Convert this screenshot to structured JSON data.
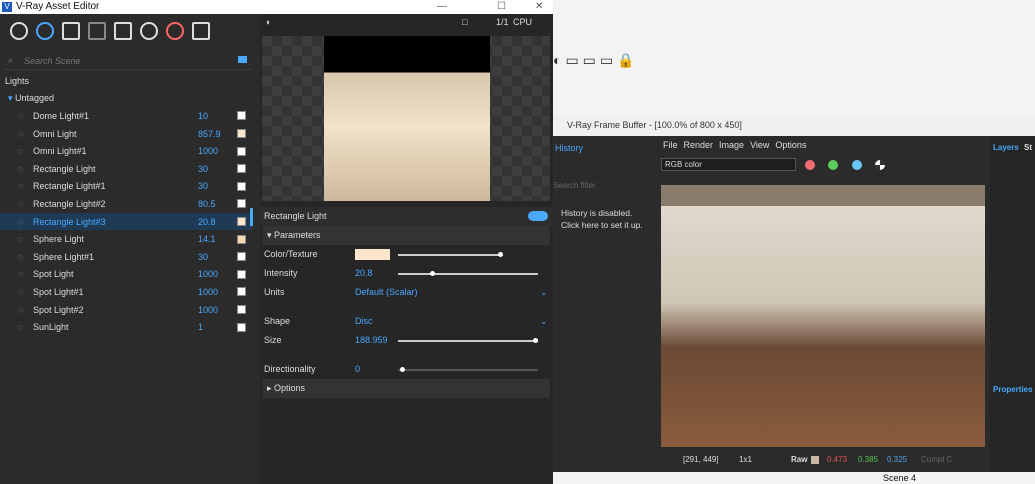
{
  "asset_editor": {
    "title": "V-Ray Asset Editor",
    "search_placeholder": "Search Scene",
    "category": "Lights",
    "tag": "Untagged",
    "lights": [
      {
        "name": "Dome Light#1",
        "value": "10",
        "color": "#ffffff"
      },
      {
        "name": "Omni Light",
        "value": "857.9",
        "color": "#fbe6cc"
      },
      {
        "name": "Omni Light#1",
        "value": "1000",
        "color": "#ffffff"
      },
      {
        "name": "Rectangle Light",
        "value": "30",
        "color": "#ffffff"
      },
      {
        "name": "Rectangle Light#1",
        "value": "30",
        "color": "#ffffff"
      },
      {
        "name": "Rectangle Light#2",
        "value": "80.5",
        "color": "#ffffff"
      },
      {
        "name": "Rectangle Light#3",
        "value": "20.8",
        "color": "#fbe6cc",
        "selected": true
      },
      {
        "name": "Sphere Light",
        "value": "14.1",
        "color": "#fbd9b0"
      },
      {
        "name": "Sphere Light#1",
        "value": "30",
        "color": "#ffffff"
      },
      {
        "name": "Spot Light",
        "value": "1000",
        "color": "#ffffff"
      },
      {
        "name": "Spot Light#1",
        "value": "1000",
        "color": "#ffffff"
      },
      {
        "name": "Spot Light#2",
        "value": "1000",
        "color": "#ffffff"
      },
      {
        "name": "SunLight",
        "value": "1",
        "color": "#ffffff"
      }
    ],
    "preview": {
      "ratio": "1/1",
      "engine": "CPU"
    },
    "props": {
      "title": "Rectangle Light",
      "parameters": "Parameters",
      "color_label": "Color/Texture",
      "intensity_label": "Intensity",
      "intensity": "20.8",
      "units_label": "Units",
      "units": "Default (Scalar)",
      "shape_label": "Shape",
      "shape": "Disc",
      "size_label": "Size",
      "size": "188.959",
      "dir_label": "Directionality",
      "dir": "0",
      "options": "Options"
    }
  },
  "frame_buffer": {
    "title": "V-Ray Frame Buffer - [100.0% of 800 x 450]",
    "history_tab": "History",
    "history_msg": "History is disabled. Click here to set it up.",
    "search_placeholder": "Search filter",
    "menus": [
      "File",
      "Render",
      "Image",
      "View",
      "Options"
    ],
    "channel": "RGB color",
    "layers_tab": "Layers",
    "st_tab": "St",
    "properties": "Properties",
    "status": {
      "coords": "[291, 449]",
      "zoom": "1x1",
      "raw": "Raw",
      "r": "0.473",
      "g": "0.385",
      "b": "0.325",
      "comp": "Compl C"
    }
  },
  "background": {
    "scene": "Scene 4"
  }
}
